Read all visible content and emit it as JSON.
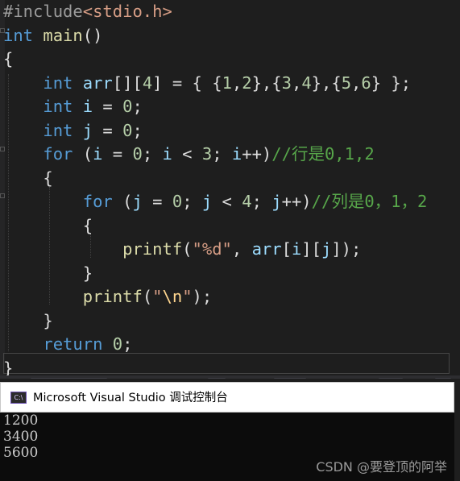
{
  "editor": {
    "lines": [
      {
        "tokens": [
          {
            "t": "#include",
            "c": "pp"
          },
          {
            "t": "<stdio.h>",
            "c": "ppinc"
          }
        ]
      },
      {
        "tokens": [
          {
            "t": "int",
            "c": "kw"
          },
          {
            "t": " "
          },
          {
            "t": "main",
            "c": "fn"
          },
          {
            "t": "()",
            "c": "punct"
          }
        ]
      },
      {
        "tokens": [
          {
            "t": "{",
            "c": "punct"
          }
        ]
      },
      {
        "tokens": [
          {
            "t": "    "
          },
          {
            "t": "int",
            "c": "kw"
          },
          {
            "t": " "
          },
          {
            "t": "arr",
            "c": "var"
          },
          {
            "t": "[][",
            "c": "punct"
          },
          {
            "t": "4",
            "c": "num"
          },
          {
            "t": "] = { {",
            "c": "punct"
          },
          {
            "t": "1",
            "c": "num"
          },
          {
            "t": ",",
            "c": "punct"
          },
          {
            "t": "2",
            "c": "num"
          },
          {
            "t": "},{",
            "c": "punct"
          },
          {
            "t": "3",
            "c": "num"
          },
          {
            "t": ",",
            "c": "punct"
          },
          {
            "t": "4",
            "c": "num"
          },
          {
            "t": "},{",
            "c": "punct"
          },
          {
            "t": "5",
            "c": "num"
          },
          {
            "t": ",",
            "c": "punct"
          },
          {
            "t": "6",
            "c": "num"
          },
          {
            "t": "} };",
            "c": "punct"
          }
        ]
      },
      {
        "tokens": [
          {
            "t": "    "
          },
          {
            "t": "int",
            "c": "kw"
          },
          {
            "t": " "
          },
          {
            "t": "i",
            "c": "var"
          },
          {
            "t": " = ",
            "c": "punct"
          },
          {
            "t": "0",
            "c": "num"
          },
          {
            "t": ";",
            "c": "punct"
          }
        ]
      },
      {
        "tokens": [
          {
            "t": "    "
          },
          {
            "t": "int",
            "c": "kw"
          },
          {
            "t": " "
          },
          {
            "t": "j",
            "c": "var"
          },
          {
            "t": " = ",
            "c": "punct"
          },
          {
            "t": "0",
            "c": "num"
          },
          {
            "t": ";",
            "c": "punct"
          }
        ]
      },
      {
        "tokens": [
          {
            "t": "    "
          },
          {
            "t": "for",
            "c": "kw"
          },
          {
            "t": " (",
            "c": "punct"
          },
          {
            "t": "i",
            "c": "var"
          },
          {
            "t": " = ",
            "c": "punct"
          },
          {
            "t": "0",
            "c": "num"
          },
          {
            "t": "; ",
            "c": "punct"
          },
          {
            "t": "i",
            "c": "var"
          },
          {
            "t": " < ",
            "c": "punct"
          },
          {
            "t": "3",
            "c": "num"
          },
          {
            "t": "; ",
            "c": "punct"
          },
          {
            "t": "i",
            "c": "var"
          },
          {
            "t": "++)",
            "c": "punct"
          },
          {
            "t": "//行是0,1,2",
            "c": "cm"
          }
        ]
      },
      {
        "tokens": [
          {
            "t": "    "
          },
          {
            "t": "{",
            "c": "punct"
          }
        ]
      },
      {
        "tokens": [
          {
            "t": "        "
          },
          {
            "t": "for",
            "c": "kw"
          },
          {
            "t": " (",
            "c": "punct"
          },
          {
            "t": "j",
            "c": "var"
          },
          {
            "t": " = ",
            "c": "punct"
          },
          {
            "t": "0",
            "c": "num"
          },
          {
            "t": "; ",
            "c": "punct"
          },
          {
            "t": "j",
            "c": "var"
          },
          {
            "t": " < ",
            "c": "punct"
          },
          {
            "t": "4",
            "c": "num"
          },
          {
            "t": "; ",
            "c": "punct"
          },
          {
            "t": "j",
            "c": "var"
          },
          {
            "t": "++)",
            "c": "punct"
          },
          {
            "t": "//列是0，1，2",
            "c": "cm"
          }
        ]
      },
      {
        "tokens": [
          {
            "t": "        "
          },
          {
            "t": "{",
            "c": "punct"
          }
        ]
      },
      {
        "tokens": [
          {
            "t": "            "
          },
          {
            "t": "printf",
            "c": "fn"
          },
          {
            "t": "(",
            "c": "punct"
          },
          {
            "t": "\"%d\"",
            "c": "str"
          },
          {
            "t": ", ",
            "c": "punct"
          },
          {
            "t": "arr",
            "c": "var"
          },
          {
            "t": "[",
            "c": "punct"
          },
          {
            "t": "i",
            "c": "var"
          },
          {
            "t": "][",
            "c": "punct"
          },
          {
            "t": "j",
            "c": "var"
          },
          {
            "t": "]);",
            "c": "punct"
          }
        ]
      },
      {
        "tokens": [
          {
            "t": "        "
          },
          {
            "t": "}",
            "c": "punct"
          }
        ]
      },
      {
        "tokens": [
          {
            "t": "        "
          },
          {
            "t": "printf",
            "c": "fn"
          },
          {
            "t": "(",
            "c": "punct"
          },
          {
            "t": "\"",
            "c": "str"
          },
          {
            "t": "\\n",
            "c": "esc"
          },
          {
            "t": "\"",
            "c": "str"
          },
          {
            "t": ");",
            "c": "punct"
          }
        ]
      },
      {
        "tokens": [
          {
            "t": "    "
          },
          {
            "t": "}",
            "c": "punct"
          }
        ]
      },
      {
        "tokens": [
          {
            "t": "    "
          },
          {
            "t": "return",
            "c": "kw"
          },
          {
            "t": " "
          },
          {
            "t": "0",
            "c": "num"
          },
          {
            "t": ";",
            "c": "punct"
          }
        ]
      },
      {
        "tokens": [
          {
            "t": "}",
            "c": "punct"
          }
        ]
      }
    ]
  },
  "console": {
    "title": "Microsoft Visual Studio 调试控制台",
    "icon": "console-app-icon",
    "icon_text": "C:\\",
    "output": [
      "1200",
      "3400",
      "5600"
    ]
  },
  "watermark": "CSDN @要登顶的阿举",
  "colors": {
    "editor_bg": "#1e1e1e",
    "keyword": "#569cd6",
    "function": "#dcdcaa",
    "string": "#d69d85",
    "number": "#b5cea8",
    "variable": "#9cdcfe",
    "comment": "#57a64a",
    "console_bg": "#0c0c0c"
  }
}
